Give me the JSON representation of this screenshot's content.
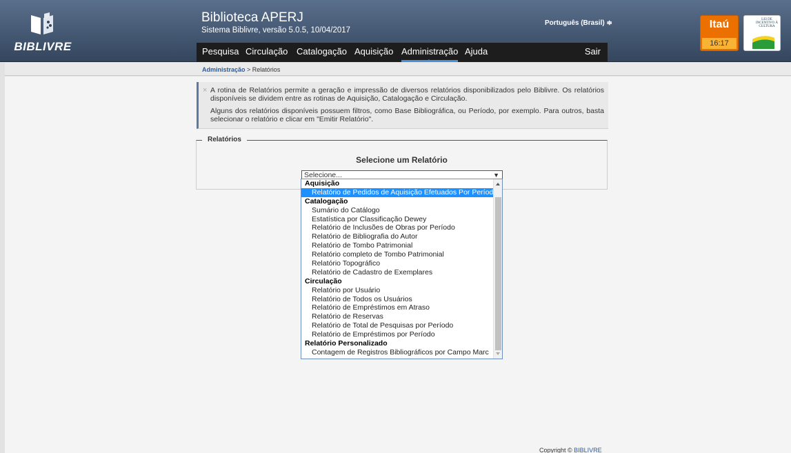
{
  "header": {
    "logo_text": "BIBLIVRE",
    "title": "Biblioteca APERJ",
    "subtitle": "Sistema Biblivre, versão 5.0.5, 10/04/2017",
    "language": "Português (Brasil) ≑",
    "itau_label": "Itaú",
    "clock": "16:17",
    "incentivo_text": "LEI DE INCENTIVO À CULTURA"
  },
  "menu": {
    "items": [
      "Pesquisa",
      "Circulação",
      "Catalogação",
      "Aquisição",
      "Administração",
      "Ajuda"
    ],
    "active": "Administração",
    "logout": "Sair"
  },
  "breadcrumb": {
    "parent": "Administração",
    "separator": " > ",
    "current": "Relatórios"
  },
  "info": {
    "close_icon": "×",
    "paragraph1": "A rotina de Relatórios permite a geração e impressão de diversos relatórios disponibilizados pelo Biblivre. Os relatórios disponíveis se dividem entre as rotinas de Aquisição, Catalogação e Circulação.",
    "paragraph2": "Alguns dos relatórios disponíveis possuem filtros, como Base Bibliográfica, ou Período, por exemplo. Para outros, basta selecionar o relatório e clicar em \"Emitir Relatório\"."
  },
  "reports": {
    "legend": "Relatórios",
    "select_title": "Selecione um Relatório",
    "select_value": "Selecione...",
    "select_arrow": "▼",
    "groups": [
      {
        "label": "Aquisição",
        "options": [
          "Relatório de Pedidos de Aquisição Efetuados Por Período"
        ]
      },
      {
        "label": "Catalogação",
        "options": [
          "Sumário do Catálogo",
          "Estatística por Classificação Dewey",
          "Relatório de Inclusões de Obras por Período",
          "Relatório de Bibliografia do Autor",
          "Relatório de Tombo Patrimonial",
          "Relatório completo de Tombo Patrimonial",
          "Relatório Topográfico",
          "Relatório de Cadastro de Exemplares"
        ]
      },
      {
        "label": "Circulação",
        "options": [
          "Relatório por Usuário",
          "Relatório de Todos os Usuários",
          "Relatório de Empréstimos em Atraso",
          "Relatório de Reservas",
          "Relatório de Total de Pesquisas por Período",
          "Relatório de Empréstimos por Período"
        ]
      },
      {
        "label": "Relatório Personalizado",
        "options": [
          "Contagem de Registros Bibliográficos por Campo Marc"
        ]
      }
    ],
    "highlighted": "Relatório de Pedidos de Aquisição Efetuados Por Período"
  },
  "footer": {
    "copyright": "Copyright © ",
    "brand": "BIBLIVRE"
  },
  "colors": {
    "header_top": "#5a6f8c",
    "header_bottom": "#34465e",
    "menu_bg": "#1d1d1d",
    "active_underline": "#4a90d9",
    "highlight": "#1e90ff",
    "itau": "#ec7000"
  }
}
